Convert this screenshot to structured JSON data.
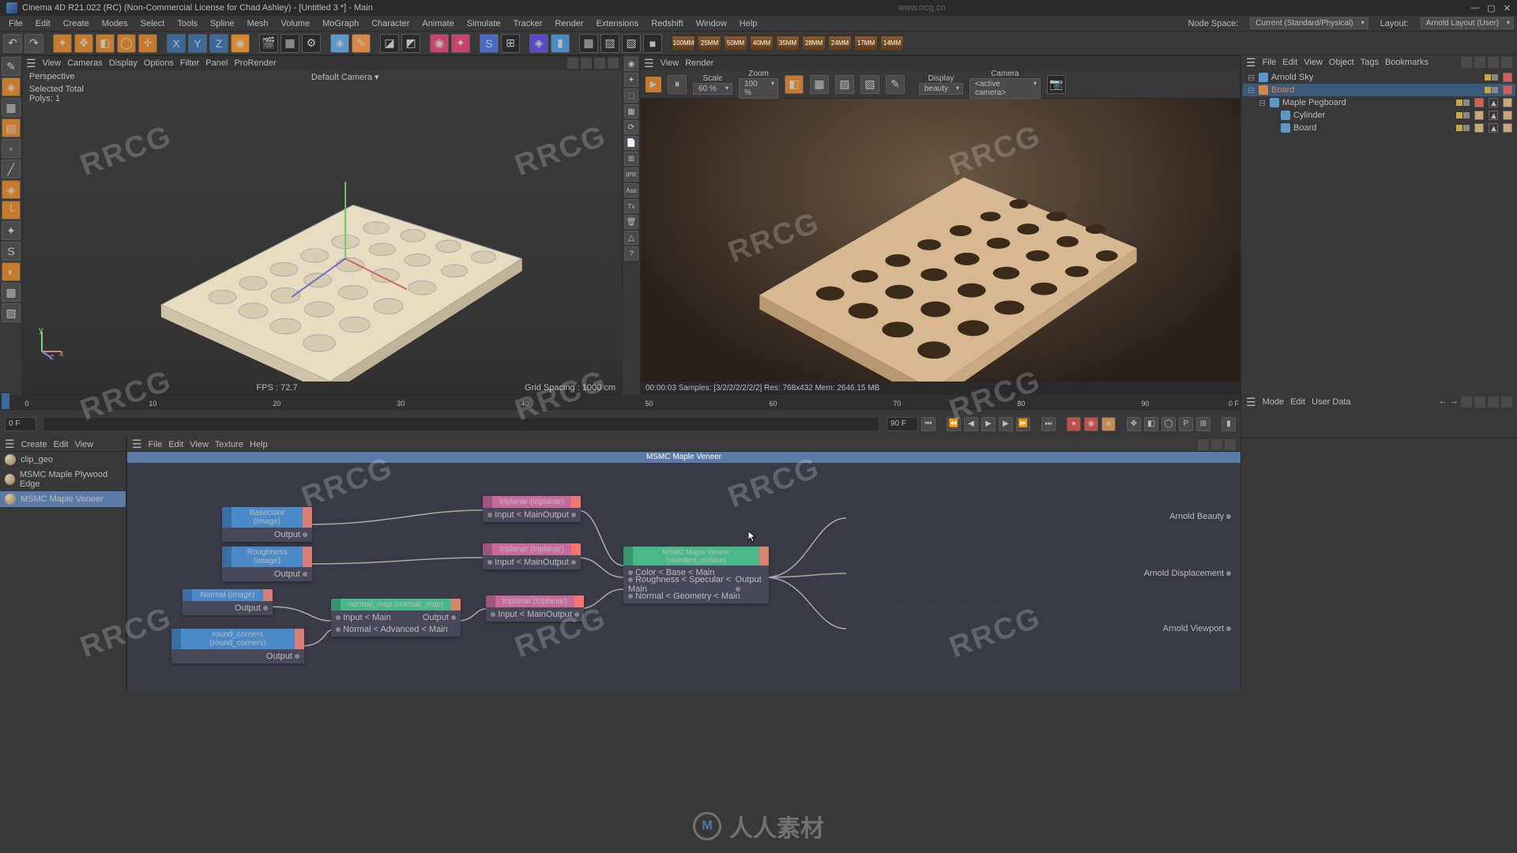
{
  "titlebar": {
    "app_icon": "c4d",
    "title": "Cinema 4D R21.022 (RC) (Non-Commercial License for Chad Ashley) - [Untitled 3 *] - Main",
    "url_hint": "www.rrcg.cn",
    "min": "—",
    "max": "▢",
    "close": "✕"
  },
  "menubar": {
    "items": [
      "File",
      "Edit",
      "Create",
      "Modes",
      "Select",
      "Tools",
      "Spline",
      "Mesh",
      "Volume",
      "MoGraph",
      "Character",
      "Animate",
      "Simulate",
      "Tracker",
      "Render",
      "Extensions",
      "Redshift",
      "Window",
      "Help"
    ],
    "node_space_label": "Node Space:",
    "node_space_value": "Current (Standard/Physical)",
    "layout_label": "Layout:",
    "layout_value": "Arnold Layout (User)"
  },
  "lenses": [
    "100MM",
    "25MM",
    "50MM",
    "40MM",
    "35MM",
    "28MM",
    "24MM",
    "17MM",
    "14MM"
  ],
  "viewport": {
    "menus": [
      "View",
      "Cameras",
      "Display",
      "Options",
      "Filter",
      "Panel",
      "ProRender"
    ],
    "mode": "Perspective",
    "camera": "Default Camera ▾",
    "selected_label": "Selected Total",
    "polys": "Polys:   1",
    "fps": "FPS : 72.7",
    "grid": "Grid Spacing : 1000 cm"
  },
  "render_panel": {
    "menus": [
      "View",
      "Render"
    ],
    "scale_label": "Scale",
    "scale_value": "60 %",
    "zoom_label": "Zoom",
    "zoom_value": "100 %",
    "display_label": "Display",
    "display_value": "beauty",
    "camera_label": "Camera",
    "camera_value": "<active camera>",
    "status": "00:00:03  Samples: [3/2/2/2/2/2/2]  Res: 768x432  Mem: 2646.15 MB"
  },
  "ipr_tools": [
    "IPR",
    "Ass",
    "Tx"
  ],
  "objects": {
    "menus": [
      "File",
      "Edit",
      "View",
      "Object",
      "Tags",
      "Bookmarks"
    ],
    "tree": [
      {
        "name": "Arnold Sky",
        "icon": "sky",
        "depth": 0,
        "sel": false
      },
      {
        "name": "Board",
        "icon": "null",
        "depth": 0,
        "sel": true,
        "color": "#d88844"
      },
      {
        "name": "Maple Pegboard",
        "icon": "extrude",
        "depth": 1,
        "sel": false
      },
      {
        "name": "Cylinder",
        "icon": "cylinder",
        "depth": 2,
        "sel": false
      },
      {
        "name": "Board",
        "icon": "cube",
        "depth": 2,
        "sel": false
      }
    ]
  },
  "timeline": {
    "start": "0 F",
    "end": "90 F",
    "current": "0 F",
    "marks": [
      "0",
      "10",
      "20",
      "30",
      "40",
      "50",
      "60",
      "70",
      "80",
      "90"
    ]
  },
  "attrib": {
    "menus": [
      "Mode",
      "Edit",
      "User Data"
    ]
  },
  "materials": {
    "menus": [
      "Create",
      "Edit",
      "View"
    ],
    "items": [
      {
        "name": "clip_geo",
        "sel": false
      },
      {
        "name": "MSMC Maple Plywood Edge",
        "sel": false
      },
      {
        "name": "MSMC Maple Veneer",
        "sel": true
      }
    ]
  },
  "node_editor": {
    "menus": [
      "File",
      "Edit",
      "View",
      "Texture",
      "Help"
    ],
    "title": "MSMC Maple Veneer",
    "endpoints": {
      "beauty": "Arnold Beauty",
      "disp": "Arnold Displacement",
      "viewport": "Arnold Viewport"
    },
    "nodes": {
      "basecolor": {
        "label": "Basecolor (image)",
        "out": "Output"
      },
      "roughness": {
        "label": "Roughness (image)",
        "out": "Output"
      },
      "normal": {
        "label": "Normal (image)",
        "out": "Output"
      },
      "round": {
        "label": "round_corners (round_corners)",
        "out": "Output"
      },
      "normalmap": {
        "label": "normal_map (normal_map)",
        "in": "Input < Main",
        "adv": "Normal < Advanced < Main",
        "out": "Output"
      },
      "tri1": {
        "label": "triplanar (triplanar)",
        "in": "Input < Main",
        "out": "Output"
      },
      "tri2": {
        "label": "triplanar (triplanar)",
        "in": "Input < Main",
        "out": "Output"
      },
      "tri3": {
        "label": "triplanar (triplanar)",
        "in": "Input < Main",
        "out": "Output"
      },
      "surf": {
        "label": "MSMC Maple Veneer (standard_surface)",
        "r1": "Color < Base < Main",
        "r2": "Roughness < Specular < Main",
        "r3": "Normal < Geometry < Main",
        "out": "Output"
      }
    }
  },
  "watermark": "RRCG",
  "footer": {
    "mark": "M",
    "text": "人人素材"
  }
}
